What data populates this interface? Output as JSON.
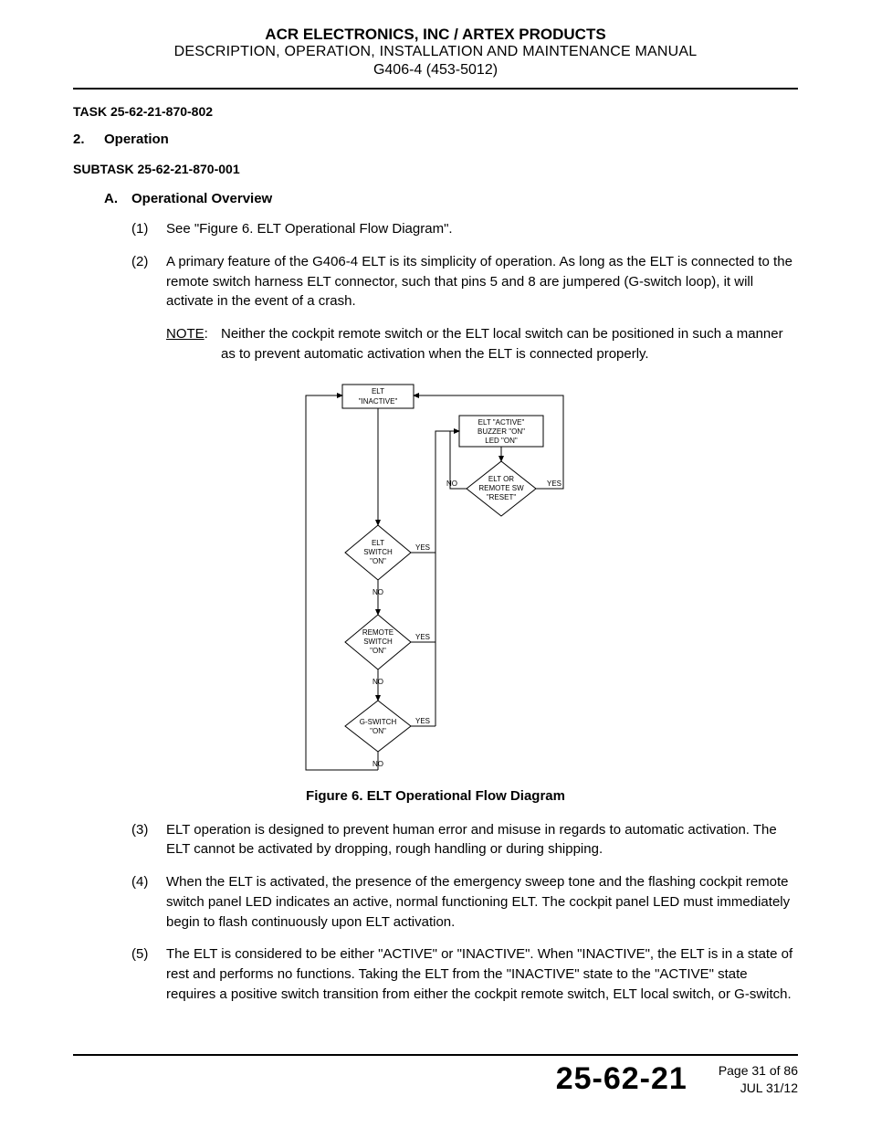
{
  "header": {
    "line1": "ACR ELECTRONICS, INC / ARTEX PRODUCTS",
    "line2": "DESCRIPTION, OPERATION, INSTALLATION AND MAINTENANCE MANUAL",
    "line3": "G406-4 (453-5012)"
  },
  "task_label": "TASK  25-62-21-870-802",
  "section": {
    "num": "2.",
    "title": "Operation"
  },
  "subtask_label": "SUBTASK  25-62-21-870-001",
  "subsection": {
    "letter": "A.",
    "title": "Operational Overview"
  },
  "items": [
    {
      "num": "(1)",
      "text": "See \"Figure 6. ELT Operational Flow Diagram\"."
    },
    {
      "num": "(2)",
      "text": "A primary feature of the G406-4 ELT is its simplicity of operation. As long as the ELT is connected to the remote switch harness ELT connector, such that pins 5 and 8 are jumpered (G-switch loop), it will activate in the event of a crash."
    }
  ],
  "note": {
    "label": "NOTE",
    "text": "Neither the cockpit remote switch or the ELT local switch can be positioned in such a manner as to prevent automatic activation when the ELT is connected properly."
  },
  "figure": {
    "caption": "Figure 6.  ELT Operational Flow Diagram",
    "nodes": {
      "inactive_l1": "ELT",
      "inactive_l2": "\"INACTIVE\"",
      "active_l1": "ELT \"ACTIVE\"",
      "active_l2": "BUZZER \"ON\"",
      "active_l3": "LED \"ON\"",
      "reset_l1": "ELT OR",
      "reset_l2": "REMOTE SW",
      "reset_l3": "\"RESET\"",
      "elt_l1": "ELT",
      "elt_l2": "SWITCH",
      "elt_l3": "\"ON\"",
      "remote_l1": "REMOTE",
      "remote_l2": "SWITCH",
      "remote_l3": "\"ON\"",
      "gsw_l1": "G-SWITCH",
      "gsw_l2": "\"ON\""
    },
    "labels": {
      "yes": "YES",
      "no": "NO"
    }
  },
  "items_after": [
    {
      "num": "(3)",
      "text": "ELT operation is designed to prevent human error and misuse in regards to automatic activation. The ELT cannot be activated by dropping, rough handling or during shipping."
    },
    {
      "num": "(4)",
      "text": "When the ELT is activated, the presence of the emergency sweep tone and the flashing cockpit remote switch panel LED indicates an active, normal functioning ELT. The cockpit panel LED must immediately begin to flash continuously upon ELT activation."
    },
    {
      "num": "(5)",
      "text": "The ELT is considered to be either \"ACTIVE\" or \"INACTIVE\". When \"INACTIVE\", the ELT is in a state of rest and performs no functions. Taking the ELT from the \"INACTIVE\" state to the \"ACTIVE\" state requires a positive switch transition from either the cockpit remote switch, ELT local switch, or G-switch."
    }
  ],
  "footer": {
    "chapter": "25-62-21",
    "page": "Page 31 of 86",
    "date": "JUL 31/12"
  }
}
